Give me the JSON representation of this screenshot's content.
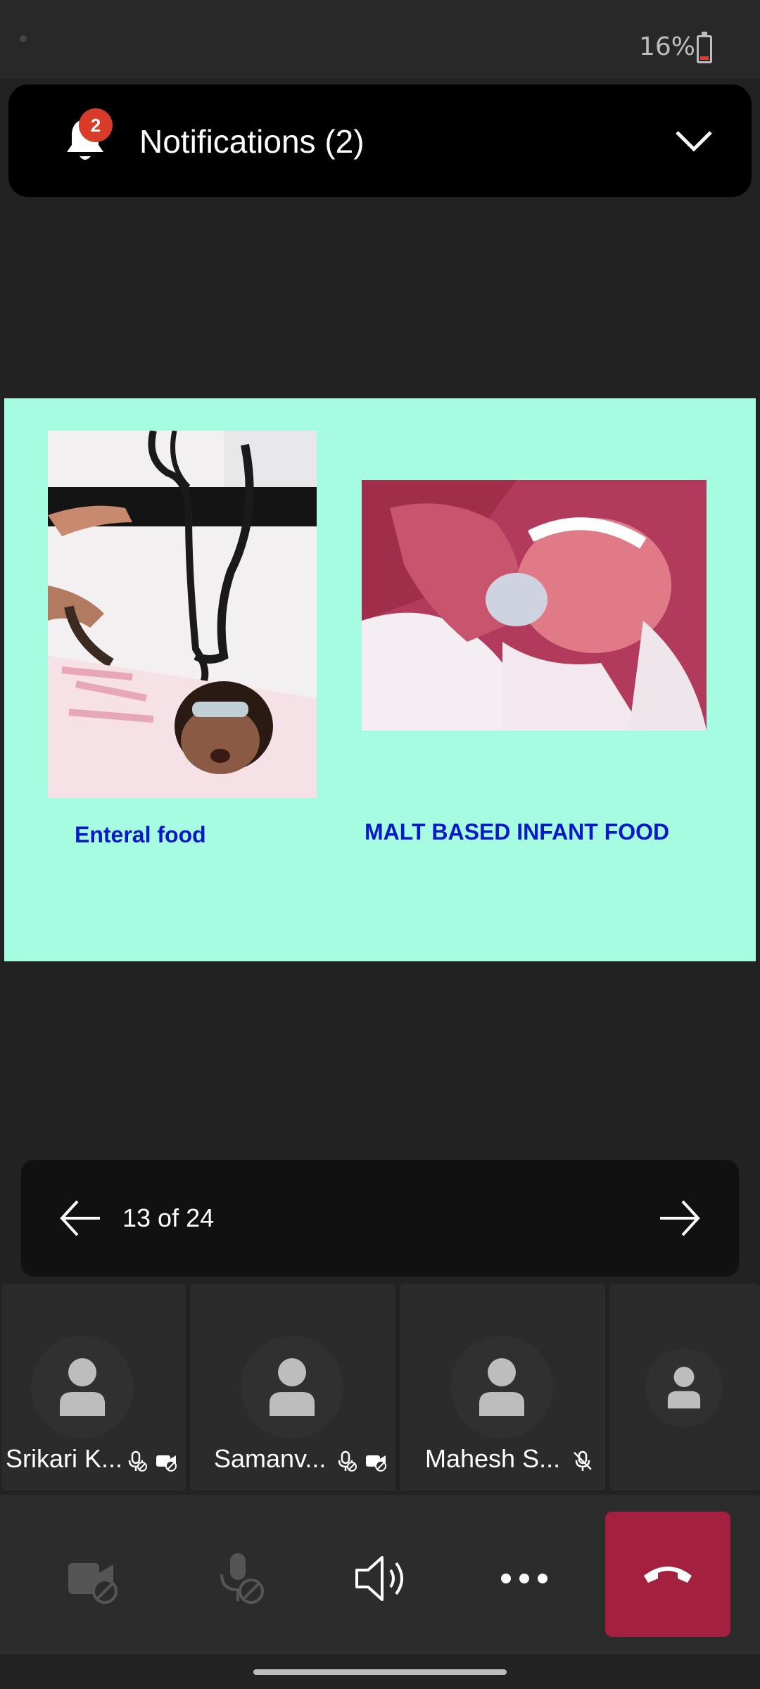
{
  "status_bar": {
    "battery": "16%"
  },
  "notifications": {
    "title": "Notifications (2)",
    "badge_count": "2"
  },
  "slide": {
    "left_caption": "Enteral food",
    "right_caption": "MALT BASED INFANT FOOD",
    "background_color": "#a5fce0",
    "caption_color": "#0a18c8"
  },
  "slide_nav": {
    "counter": "13 of 24"
  },
  "participants": [
    {
      "name": "Srikari K...",
      "icons": [
        "mic-off-icon",
        "video-off-icon"
      ]
    },
    {
      "name": "Samanv...",
      "icons": [
        "mic-off-icon",
        "video-off-icon"
      ]
    },
    {
      "name": "Mahesh S...",
      "icons": [
        "muted-icon"
      ]
    },
    {
      "name": "",
      "icons": []
    }
  ],
  "controls": {
    "icons": [
      "camera-off-icon",
      "mic-off-icon",
      "speaker-icon",
      "more-icon",
      "hang-up-icon"
    ],
    "hangup_color": "#a4203f"
  }
}
